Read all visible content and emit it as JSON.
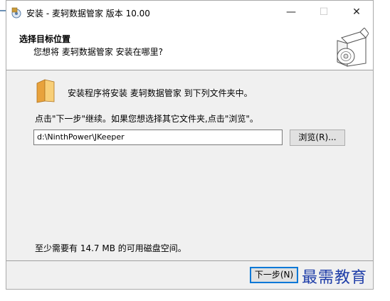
{
  "window": {
    "title": "安装 - 麦轲数据管家 版本 10.00"
  },
  "controls": {
    "minimize": "—",
    "maximize": "☐",
    "close": "✕"
  },
  "header": {
    "title": "选择目标位置",
    "subtitle": "您想将 麦轲数据管家 安装在哪里?"
  },
  "body": {
    "folder_text": "安装程序将安装 麦轲数据管家 到下列文件夹中。",
    "instruction": "点击\"下一步\"继续。如果您想选择其它文件夹,点击\"浏览\"。",
    "path_value": "d:\\NinthPower\\JKeeper",
    "browse_label": "浏览(R)...",
    "disk_space": "至少需要有 14.7 MB 的可用磁盘空间。"
  },
  "footer": {
    "next_label": "下一步(N)"
  },
  "watermark": "最需教育",
  "icons": {
    "app": "installer-icon",
    "folder": "folder-icon",
    "header": "box-disc-icon"
  }
}
